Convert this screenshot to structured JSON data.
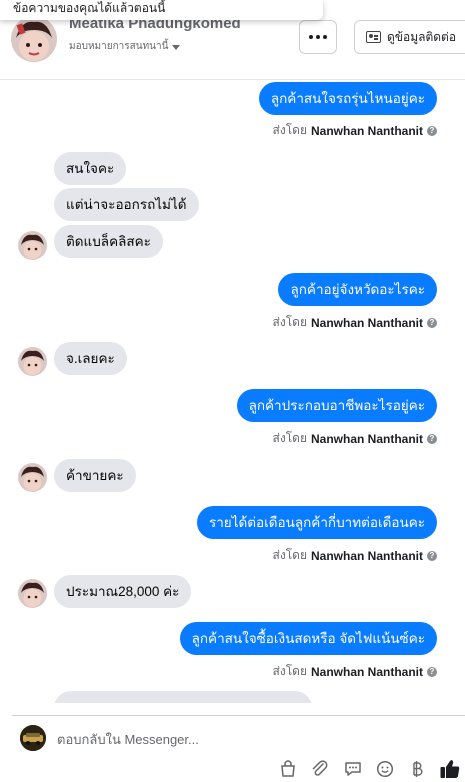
{
  "toast": {
    "text": "ข้อความของคุณได้แล้วตอนนี้"
  },
  "header": {
    "name": "Meatika Phadungkomed",
    "assign_label": "มอบหมายการสนทนานี้",
    "contact_label": "ดูข้อมูลติดต่อ"
  },
  "sent_by_prefix": "ส่งโดย",
  "sent_by_name": "Nanwhan Nanthanit",
  "messages": [
    {
      "side": "out",
      "text": "ลูกค้าสนใจรถรุ่นไหนอยู่คะ"
    },
    {
      "side": "in",
      "text": "สนใจคะ"
    },
    {
      "side": "in",
      "text": "แต่น่าจะออกรถไม่ได้"
    },
    {
      "side": "in",
      "text": "ติดแบล็คลิสคะ"
    },
    {
      "side": "out",
      "text": "ลูกค้าอยู่จังหวัดอะไรคะ"
    },
    {
      "side": "in",
      "text": "จ.เลยคะ"
    },
    {
      "side": "out",
      "text": "ลูกค้าประกอบอาชีพอะไรอยู่คะ"
    },
    {
      "side": "in",
      "text": "ค้าขายคะ"
    },
    {
      "side": "out",
      "text": "รายได้ต่อเดือนลูกค้ากี่บาทต่อเดือนคะ"
    },
    {
      "side": "in",
      "text": "ประมาณ28,000 ค่ะ"
    },
    {
      "side": "out",
      "text": "ลูกค้าสนใจซื้อเงินสดหรือ จัดไฟแน้นซ์คะ"
    }
  ],
  "composer": {
    "placeholder": "ตอบกลับใน Messenger..."
  },
  "icons": [
    "shopping-bag-icon",
    "paperclip-icon",
    "chat-reply-icon",
    "emoji-icon",
    "baht-icon",
    "thumbs-up-icon"
  ],
  "colors": {
    "outgoing_bubble": "#0a7cff",
    "incoming_bubble": "#e4e6eb",
    "like": "#1c1e21"
  }
}
